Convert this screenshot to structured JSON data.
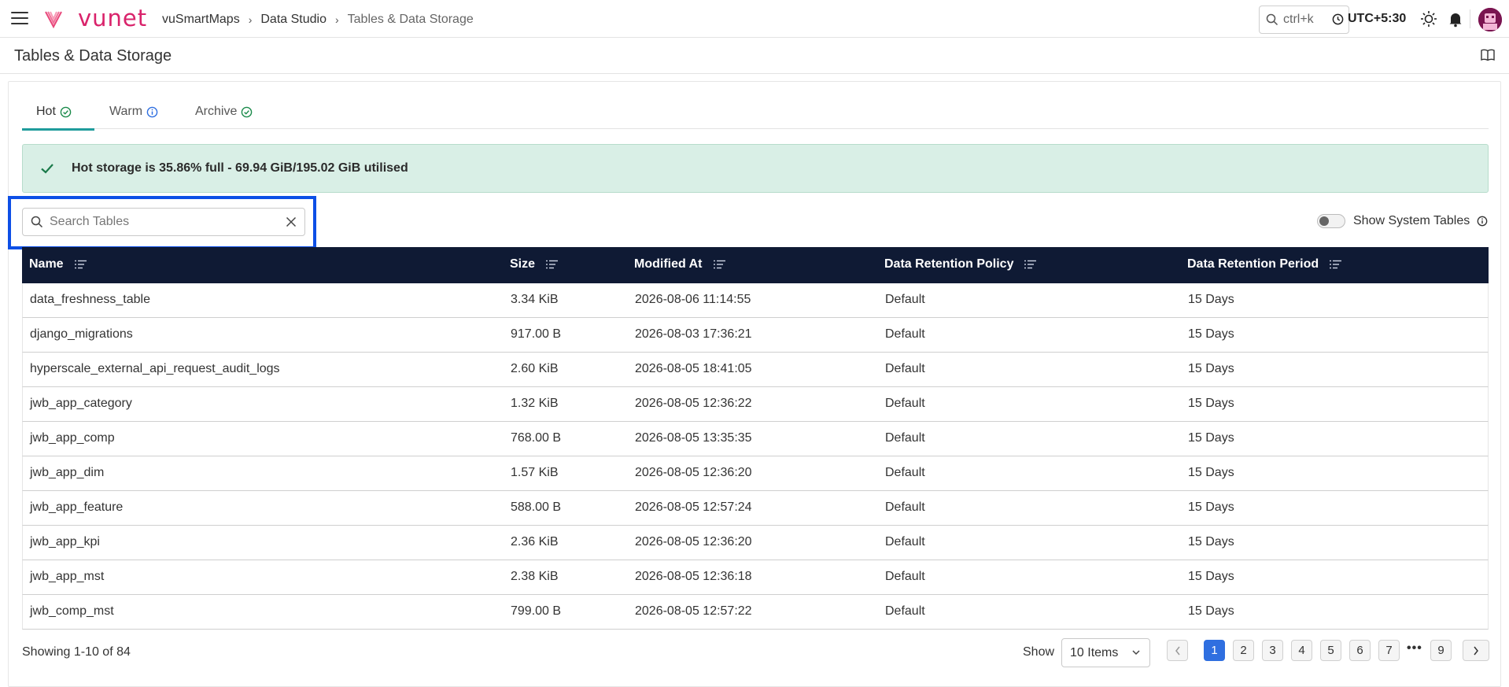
{
  "header": {
    "logo_text": "vunet",
    "breadcrumb": [
      "vuSmartMaps",
      "Data Studio",
      "Tables & Data Storage"
    ],
    "search_shortcut": "ctrl+k",
    "timezone": "UTC+5:30"
  },
  "page": {
    "title": "Tables & Data Storage"
  },
  "tabs": [
    {
      "label": "Hot",
      "status": "check",
      "active": true
    },
    {
      "label": "Warm",
      "status": "info",
      "active": false
    },
    {
      "label": "Archive",
      "status": "check",
      "active": false
    }
  ],
  "banner": {
    "text": "Hot storage is 35.86% full - 69.94 GiB/195.02 GiB utilised",
    "color": "#d9efe6"
  },
  "search": {
    "placeholder": "Search Tables",
    "value": ""
  },
  "system_tables": {
    "label": "Show System Tables",
    "enabled": false
  },
  "table": {
    "columns": [
      "Name",
      "Size",
      "Modified At",
      "Data Retention Policy",
      "Data Retention Period"
    ],
    "rows": [
      [
        "data_freshness_table",
        "3.34 KiB",
        "2026-08-06 11:14:55",
        "Default",
        "15 Days"
      ],
      [
        "django_migrations",
        "917.00 B",
        "2026-08-03 17:36:21",
        "Default",
        "15 Days"
      ],
      [
        "hyperscale_external_api_request_audit_logs",
        "2.60 KiB",
        "2026-08-05 18:41:05",
        "Default",
        "15 Days"
      ],
      [
        "jwb_app_category",
        "1.32 KiB",
        "2026-08-05 12:36:22",
        "Default",
        "15 Days"
      ],
      [
        "jwb_app_comp",
        "768.00 B",
        "2026-08-05 13:35:35",
        "Default",
        "15 Days"
      ],
      [
        "jwb_app_dim",
        "1.57 KiB",
        "2026-08-05 12:36:20",
        "Default",
        "15 Days"
      ],
      [
        "jwb_app_feature",
        "588.00 B",
        "2026-08-05 12:57:24",
        "Default",
        "15 Days"
      ],
      [
        "jwb_app_kpi",
        "2.36 KiB",
        "2026-08-05 12:36:20",
        "Default",
        "15 Days"
      ],
      [
        "jwb_app_mst",
        "2.38 KiB",
        "2026-08-05 12:36:18",
        "Default",
        "15 Days"
      ],
      [
        "jwb_comp_mst",
        "799.00 B",
        "2026-08-05 12:57:22",
        "Default",
        "15 Days"
      ]
    ]
  },
  "footer": {
    "showing": "Showing 1-10 of 84",
    "show_label": "Show",
    "items_per_page": "10 Items",
    "pages": [
      "1",
      "2",
      "3",
      "4",
      "5",
      "6",
      "7",
      "9"
    ],
    "ellipsis": "•••",
    "current_page": "1"
  },
  "colors": {
    "brand": "#d9236b",
    "table_header": "#0f1a34",
    "accent_tab": "#1f9c9c",
    "active_page": "#2f6fe0",
    "highlight": "#0d4fe6"
  }
}
